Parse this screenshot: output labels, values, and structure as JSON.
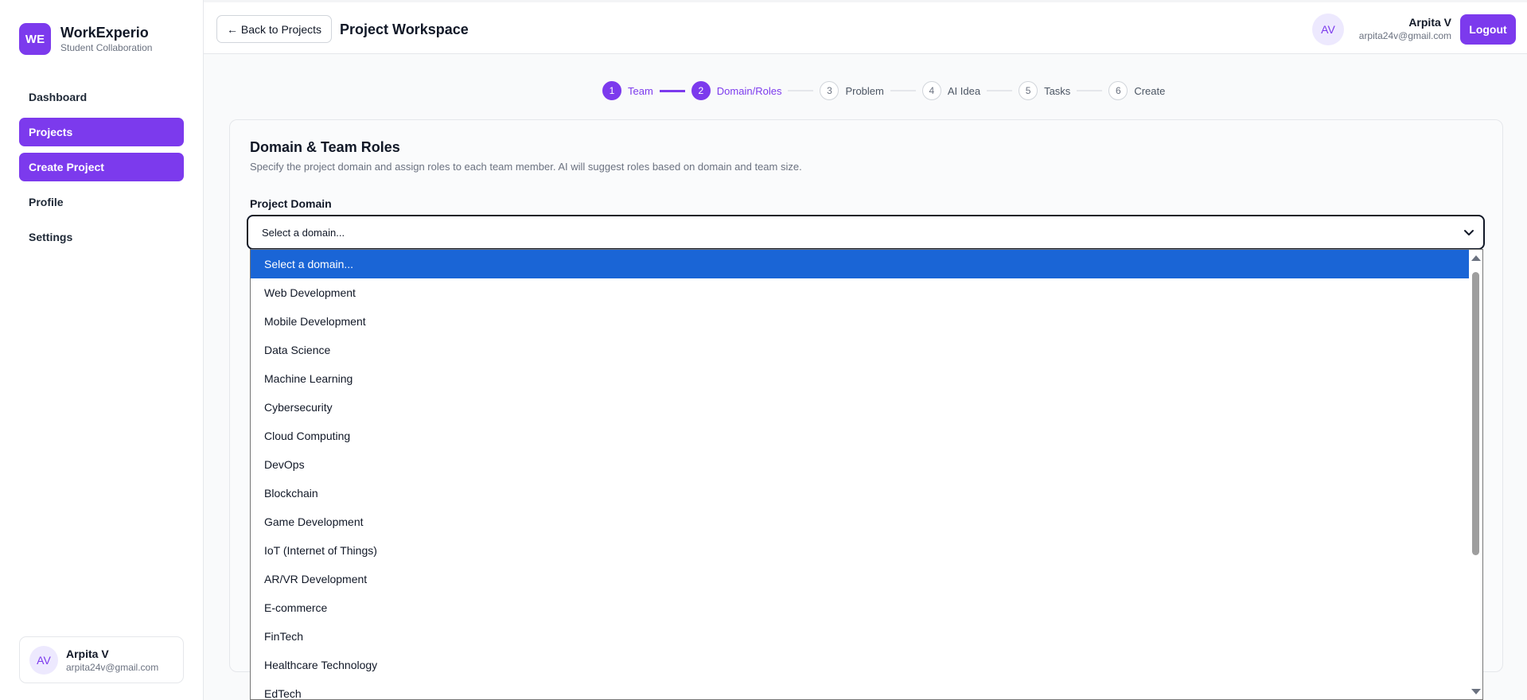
{
  "brand": {
    "logo": "WE",
    "title": "WorkExperio",
    "subtitle": "Student Collaboration"
  },
  "sidebar": {
    "items": [
      {
        "label": "Dashboard",
        "active": false
      },
      {
        "label": "Projects",
        "active": true
      },
      {
        "label": "Create Project",
        "active": true
      },
      {
        "label": "Profile",
        "active": false
      },
      {
        "label": "Settings",
        "active": false
      }
    ],
    "user": {
      "initials": "AV",
      "name": "Arpita V",
      "email": "arpita24v@gmail.com"
    }
  },
  "header": {
    "back_label": "← Back to Projects",
    "title": "Project Workspace",
    "user": {
      "initials": "AV",
      "name": "Arpita V",
      "email": "arpita24v@gmail.com"
    },
    "logout_label": "Logout"
  },
  "stepper": {
    "steps": [
      {
        "num": "1",
        "label": "Team"
      },
      {
        "num": "2",
        "label": "Domain/Roles"
      },
      {
        "num": "3",
        "label": "Problem"
      },
      {
        "num": "4",
        "label": "AI Idea"
      },
      {
        "num": "5",
        "label": "Tasks"
      },
      {
        "num": "6",
        "label": "Create"
      }
    ],
    "current": 2
  },
  "card": {
    "title": "Domain & Team Roles",
    "description": "Specify the project domain and assign roles to each team member. AI will suggest roles based on domain and team size.",
    "domain_label": "Project Domain",
    "select_value": "Select a domain...",
    "options": [
      "Select a domain...",
      "Web Development",
      "Mobile Development",
      "Data Science",
      "Machine Learning",
      "Cybersecurity",
      "Cloud Computing",
      "DevOps",
      "Blockchain",
      "Game Development",
      "IoT (Internet of Things)",
      "AR/VR Development",
      "E-commerce",
      "FinTech",
      "Healthcare Technology",
      "EdTech"
    ]
  },
  "colors": {
    "accent": "#7c3aed",
    "selected_option": "#1a65d6"
  },
  "icons": {
    "select": "chevron-down-icon"
  }
}
